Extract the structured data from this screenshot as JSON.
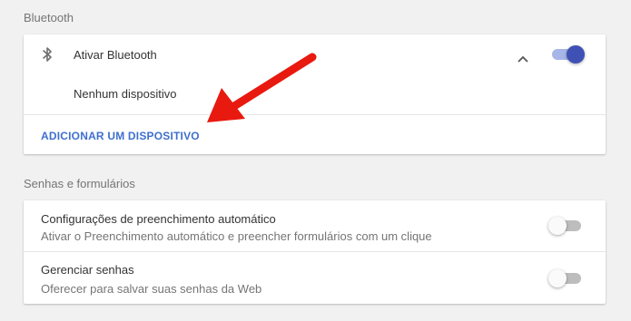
{
  "bluetooth": {
    "section_title": "Bluetooth",
    "enable_label": "Ativar Bluetooth",
    "enabled": true,
    "no_devices": "Nenhum dispositivo",
    "add_device": "ADICIONAR UM DISPOSITIVO"
  },
  "passwords": {
    "section_title": "Senhas e formulários",
    "items": [
      {
        "title": "Configurações de preenchimento automático",
        "subtitle": "Ativar o Preenchimento automático e preencher formulários com um clique",
        "enabled": false
      },
      {
        "title": "Gerenciar senhas",
        "subtitle": "Oferecer para salvar suas senhas da Web",
        "enabled": false
      }
    ]
  },
  "colors": {
    "accent": "#3f51b5",
    "link": "#3f6fcf",
    "annotation_arrow": "#e8190f"
  },
  "icons": [
    "bluetooth-icon",
    "chevron-up-icon"
  ]
}
